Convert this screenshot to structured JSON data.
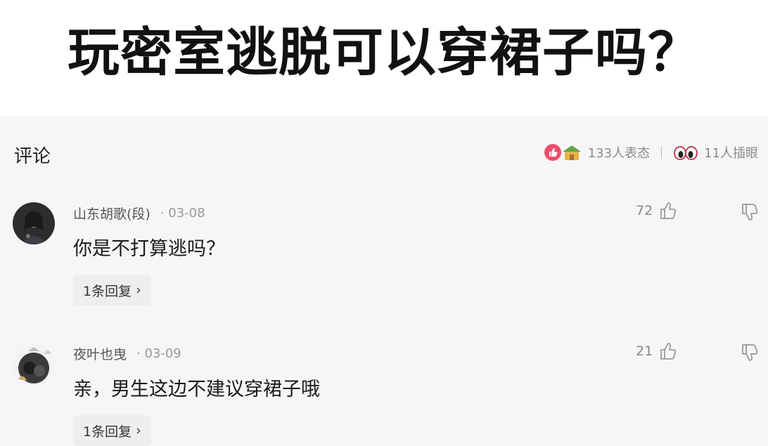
{
  "page": {
    "title": "玩密室逃脱可以穿裙子吗？"
  },
  "section": {
    "title": "评论",
    "reactions_label": "133人表态",
    "watchers_label": "11人插眼"
  },
  "comments": [
    {
      "author": "山东胡歌(段)",
      "date": "· 03-08",
      "text": "你是不打算逃吗？",
      "likes": "72",
      "reply_label": "1条回复",
      "reply_chevron": "›"
    },
    {
      "author": "夜叶也曳",
      "date": "· 03-09",
      "text": "亲，男生这边不建议穿裙子哦",
      "likes": "21",
      "reply_label": "1条回复",
      "reply_chevron": "›"
    }
  ],
  "icons": {
    "like_badge": "thumbs-up-icon",
    "house_badge": "house-icon",
    "eyes": "eyes-icon",
    "like": "thumbs-up-outline-icon",
    "dislike": "thumbs-down-outline-icon"
  },
  "colors": {
    "accent": "#ef4d6c",
    "text": "#1a1a1a",
    "muted": "#999999"
  }
}
